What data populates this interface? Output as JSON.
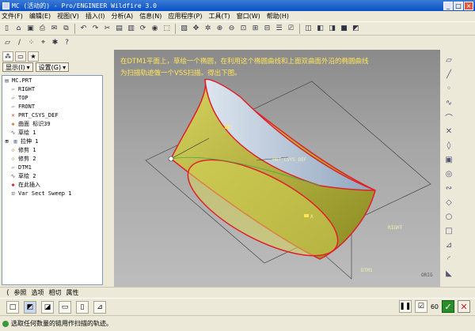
{
  "window": {
    "title": "MC (活动的) - Pro/ENGINEER Wildfire 3.0"
  },
  "menu": [
    "文件(F)",
    "编辑(E)",
    "视图(V)",
    "插入(I)",
    "分析(A)",
    "信息(N)",
    "应用程序(P)",
    "工具(T)",
    "窗口(W)",
    "帮助(H)"
  ],
  "left_panel": {
    "show_label": "显示(I)",
    "settings_label": "设置(G)",
    "tree": [
      {
        "icon": "part-icon",
        "label": "MC.PRT"
      },
      {
        "icon": "datum-plane-icon",
        "label": "RIGHT"
      },
      {
        "icon": "datum-plane-icon",
        "label": "TOP"
      },
      {
        "icon": "datum-plane-icon",
        "label": "FRONT"
      },
      {
        "icon": "csys-icon",
        "label": "PRT_CSYS_DEF"
      },
      {
        "icon": "surface-icon",
        "label": "曲面 标识39"
      },
      {
        "icon": "sketch-icon",
        "label": "草绘 1"
      },
      {
        "icon": "extrude-icon",
        "label": "拉伸 1"
      },
      {
        "icon": "trim-icon",
        "label": "修剪 1"
      },
      {
        "icon": "trim-icon",
        "label": "修剪 2"
      },
      {
        "icon": "datum-plane-icon",
        "label": "DTM1"
      },
      {
        "icon": "sketch-icon",
        "label": "草绘 2"
      },
      {
        "icon": "insert-here-icon",
        "label": "在此插入"
      },
      {
        "icon": "var-sect-sweep-icon",
        "label": "Var Sect Sweep 1"
      }
    ]
  },
  "viewport": {
    "annotation_line1": "在DTM1平面上，草绘一个椭圆，在利用这个椭圆曲线和上面双曲面外沿的椭圆曲线",
    "annotation_line2": "为扫描轨迹做一个VSS扫描。得出下图。",
    "labels": {
      "right": "RIGHT",
      "dtm1": "DTM1",
      "csys": "PRT_CSYS_DEF",
      "origin": "ORIG",
      "t1": "T1",
      "x": "X"
    },
    "colors": {
      "surface": "#c8c448",
      "edge": "#e0202a",
      "inner": "#b8c8d8",
      "background": "#a6a6a6"
    }
  },
  "dashboard": {
    "tabs": [
      "参照",
      "选项",
      "相切",
      "属性"
    ],
    "pause_icon": "pause-icon",
    "preview_label": "60"
  },
  "status": {
    "message": "选取任何数量的链用作扫描的轨迹。"
  }
}
